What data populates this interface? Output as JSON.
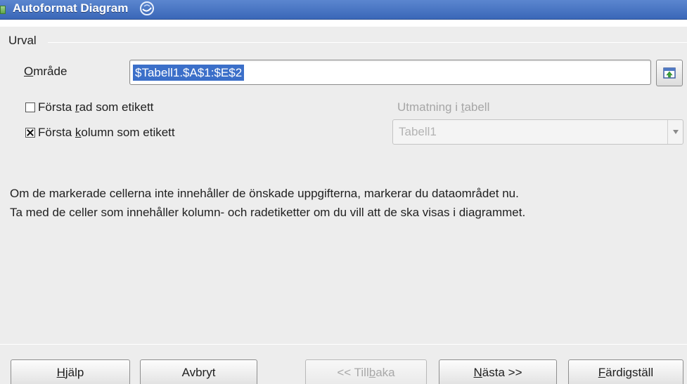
{
  "window": {
    "title": "Autoformat Diagram"
  },
  "selection": {
    "group_label": "Urval",
    "range_label_mnemonic": "O",
    "range_label_rest": "mråde",
    "range_value": "$Tabell1.$A$1:$E$2",
    "first_row_label_pre": "Första ",
    "first_row_label_mnemonic": "r",
    "first_row_label_post": "ad som etikett",
    "first_row_checked": false,
    "first_col_label_pre": "Första ",
    "first_col_label_mnemonic": "k",
    "first_col_label_post": "olumn som etikett",
    "first_col_checked": true,
    "output_label_pre": "Utmatning i ",
    "output_label_mnemonic": "t",
    "output_label_post": "abell",
    "output_table_value": "Tabell1"
  },
  "info": {
    "line1": "Om de markerade cellerna inte innehåller de önskade uppgifterna, markerar du dataområdet nu.",
    "line2": "Ta med de celler som innehåller kolumn- och radetiketter om du vill att de ska visas i diagrammet."
  },
  "buttons": {
    "help_mn": "H",
    "help_rest": "jälp",
    "cancel": "Avbryt",
    "back_pre": "<< Till",
    "back_mn": "b",
    "back_post": "aka",
    "next_mn": "N",
    "next_rest": "ästa >>",
    "finish_mn": "F",
    "finish_rest": "ärdigställ"
  }
}
